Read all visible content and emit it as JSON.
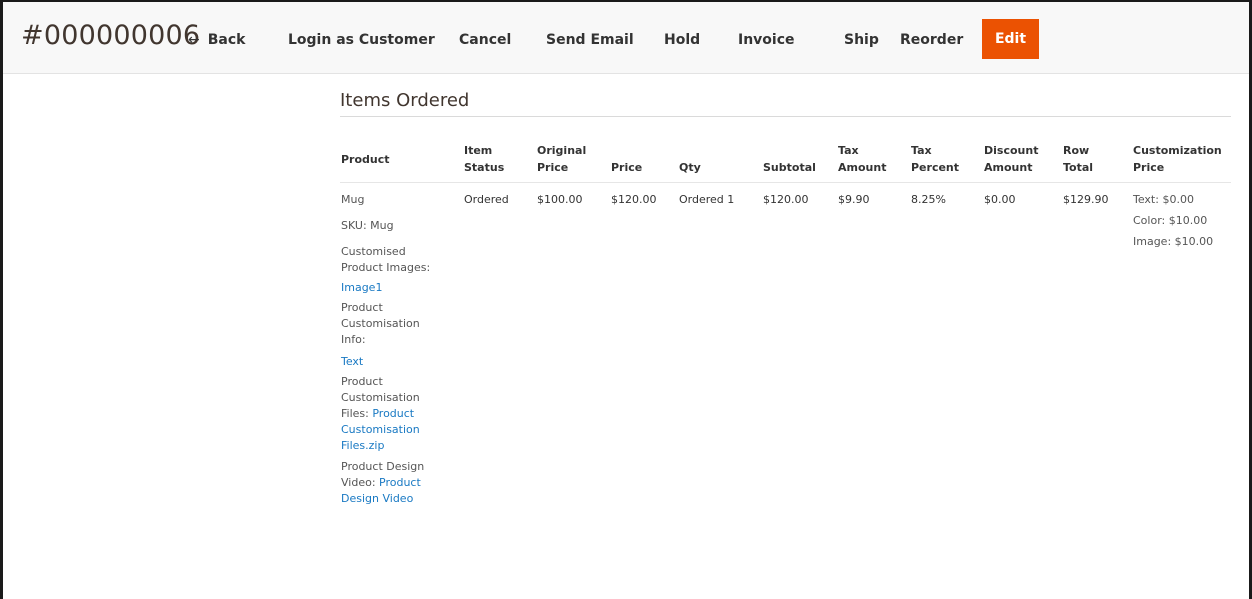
{
  "header": {
    "order_id": "#000000006",
    "back_label": "Back",
    "login_as_customer_label": "Login as Customer",
    "cancel_label": "Cancel",
    "send_email_label": "Send Email",
    "hold_label": "Hold",
    "invoice_label": "Invoice",
    "ship_label": "Ship",
    "reorder_label": "Reorder",
    "edit_label": "Edit"
  },
  "section": {
    "title": "Items Ordered"
  },
  "columns": {
    "product": "Product",
    "item_status": [
      "Item",
      "Status"
    ],
    "original_price": [
      "Original",
      "Price"
    ],
    "price": "Price",
    "qty": "Qty",
    "subtotal": "Subtotal",
    "tax_amount": [
      "Tax",
      "Amount"
    ],
    "tax_percent": [
      "Tax",
      "Percent"
    ],
    "discount_amount": [
      "Discount",
      "Amount"
    ],
    "row_total": [
      "Row",
      "Total"
    ],
    "customization_price": [
      "Customization",
      "Price"
    ]
  },
  "row": {
    "product_name": "Mug",
    "sku": "SKU: Mug",
    "images_label": [
      "Customised",
      "Product Images:"
    ],
    "images_link": "Image1",
    "info_label": [
      "Product",
      "Customisation",
      "Info:"
    ],
    "info_link": "Text",
    "files_label": [
      "Product",
      "Customisation"
    ],
    "files_prefix": "Files:",
    "files_link": [
      "Product",
      "Customisation",
      "Files.zip"
    ],
    "video_label": "Product Design",
    "video_prefix": "Video:",
    "video_link": [
      "Product",
      "Design Video"
    ],
    "item_status": "Ordered",
    "original_price": "$100.00",
    "price": "$120.00",
    "qty": "Ordered 1",
    "subtotal": "$120.00",
    "tax_amount": "$9.90",
    "tax_percent": "8.25%",
    "discount_amount": "$0.00",
    "row_total": "$129.90",
    "customization": [
      "Text: $0.00",
      "Color: $10.00",
      "Image: $10.00"
    ]
  },
  "colors": {
    "accent": "#eb5202",
    "link": "#1979c3"
  },
  "icons": {
    "back": "left-arrow-icon"
  }
}
